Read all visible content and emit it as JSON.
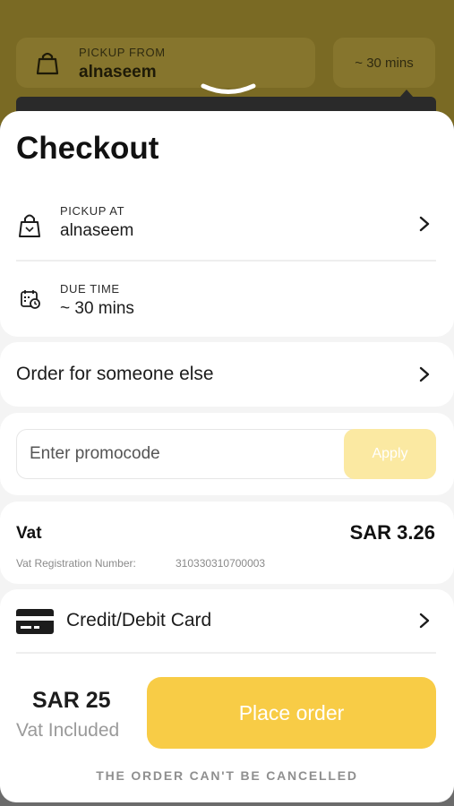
{
  "background": {
    "pickup_label": "PICKUP FROM",
    "pickup_value": "alnaseem",
    "time_value": "~ 30 mins",
    "bag_icon": "shopping-bag-icon",
    "handle_icon": "chevron-down-icon"
  },
  "checkout": {
    "title": "Checkout",
    "pickup": {
      "label": "PICKUP AT",
      "value": "alnaseem",
      "icon": "shopping-bag-icon"
    },
    "due_time": {
      "label": "DUE TIME",
      "value": "~ 30 mins",
      "icon": "calendar-clock-icon"
    },
    "order_for_other": {
      "label": "Order for someone else"
    },
    "promo": {
      "placeholder": "Enter promocode",
      "apply_label": "Apply"
    },
    "vat": {
      "label": "Vat",
      "amount": "SAR 3.26",
      "registration_label": "Vat Registration Number:",
      "registration_number": "310330310700003"
    },
    "payment": {
      "label": "Credit/Debit Card",
      "icon": "credit-card-icon"
    },
    "footer": {
      "total": "SAR 25",
      "total_note": "Vat Included",
      "place_order_label": "Place order",
      "cancel_note": "THE ORDER CAN'T BE CANCELLED"
    }
  },
  "colors": {
    "accent": "#f8cc46",
    "accent_disabled": "#fbe9a2",
    "overlay": "#7a6a24"
  }
}
